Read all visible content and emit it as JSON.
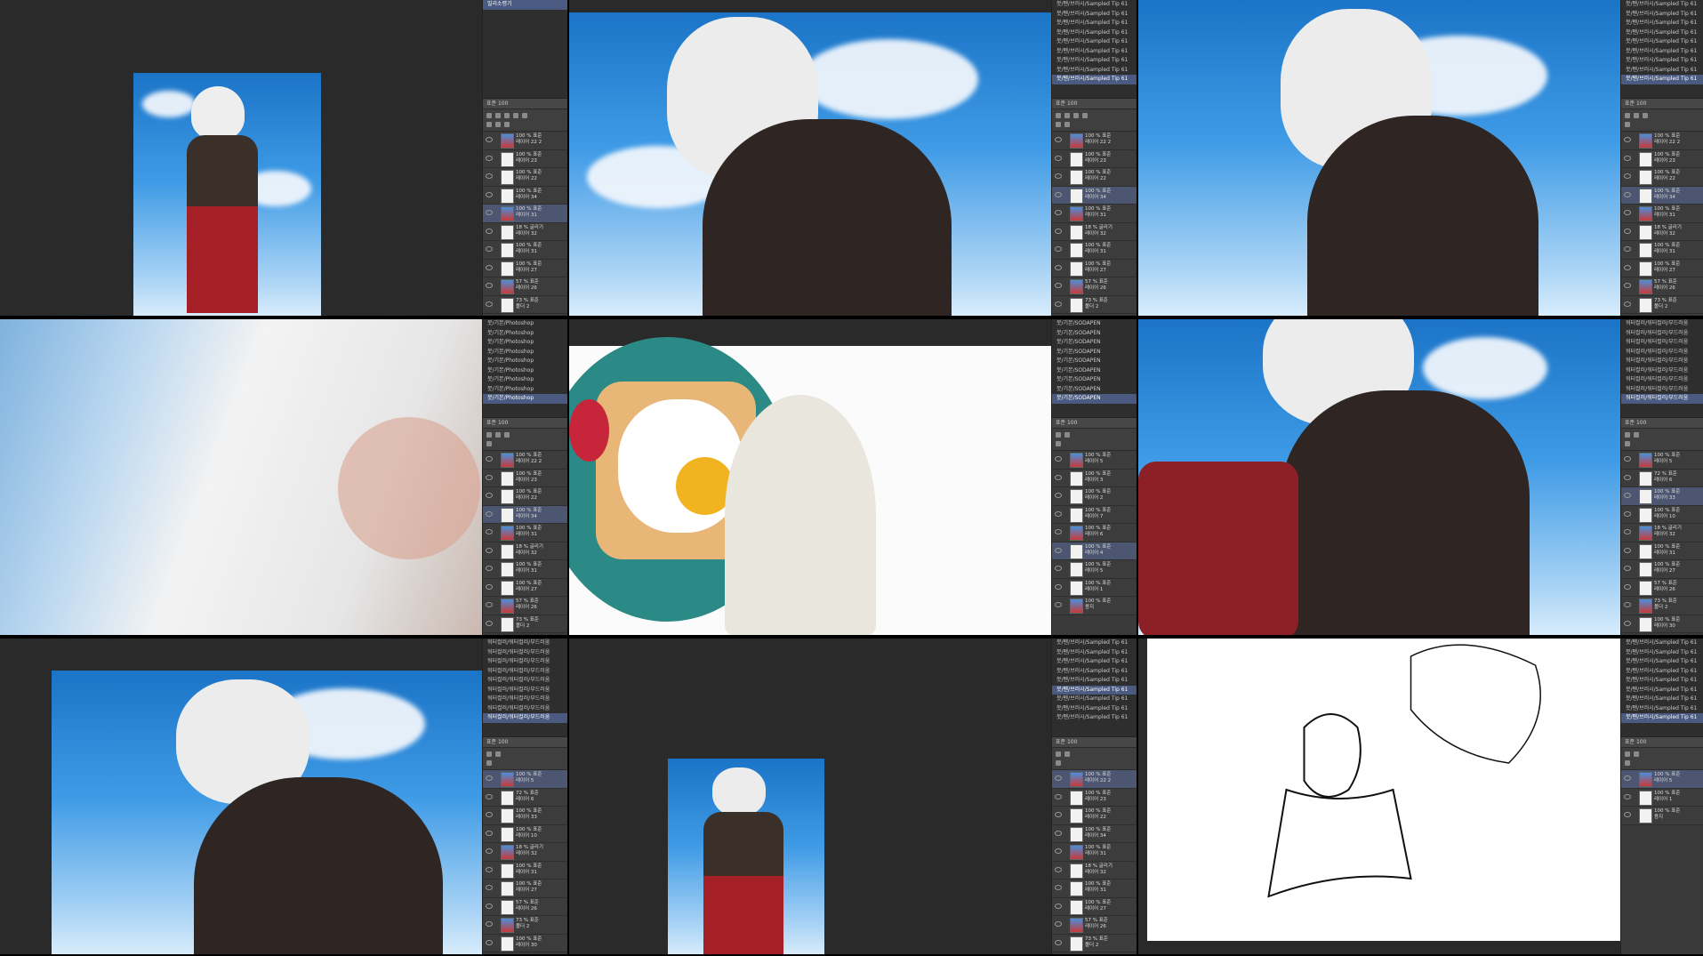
{
  "colors": {
    "sel": "#4a5a80",
    "panel": "#3a3a3a",
    "canvas": "#2a2a2a"
  },
  "icons": [
    "eye-icon",
    "layer-thumbnail"
  ],
  "brushes": {
    "sampled": [
      "붓/펜/브러시/Sampled Tip 61",
      "붓/펜/브러시/Sampled Tip 61",
      "붓/펜/브러시/Sampled Tip 61",
      "붓/펜/브러시/Sampled Tip 61",
      "붓/펜/브러시/Sampled Tip 61",
      "붓/펜/브러시/Sampled Tip 61",
      "붓/펜/브러시/Sampled Tip 61",
      "붓/펜/브러시/Sampled Tip 61",
      "붓/펜/브러시/Sampled Tip 61"
    ],
    "photoshop": [
      "붓/기본/Photoshop",
      "붓/기본/Photoshop",
      "붓/기본/Photoshop",
      "붓/기본/Photoshop",
      "붓/기본/Photoshop",
      "붓/기본/Photoshop",
      "붓/기본/Photoshop",
      "붓/기본/Photoshop",
      "붓/기본/Photoshop"
    ],
    "sodapen": [
      "붓/기본/SODAPEN",
      "붓/기본/SODAPEN",
      "붓/기본/SODAPEN",
      "붓/기본/SODAPEN",
      "붓/기본/SODAPEN",
      "붓/기본/SODAPEN",
      "붓/기본/SODAPEN",
      "붓/기본/SODAPEN",
      "붓/기본/SODAPEN"
    ],
    "watercolor": [
      "워터컬러/워터컬러/부드러움",
      "워터컬러/워터컬러/부드러움",
      "워터컬러/워터컬러/부드러움",
      "워터컬러/워터컬러/부드러움",
      "워터컬러/워터컬러/부드러움",
      "워터컬러/워터컬러/부드러움",
      "워터컬러/워터컬러/부드러움",
      "워터컬러/워터컬러/부드러움",
      "워터컬러/워터컬러/부드러움"
    ],
    "top_item": "밀리소령기"
  },
  "panel": {
    "blend": "표준",
    "opacity": "100"
  },
  "layers": {
    "a": [
      [
        "100 % 표준",
        "레이어 22 2"
      ],
      [
        "100 % 표준",
        "레이어 23"
      ],
      [
        "100 % 표준",
        "레이어 22"
      ],
      [
        "100 % 표준",
        "레이어 34"
      ],
      [
        "100 % 표준",
        "레이어 31"
      ],
      [
        "18 % 글리기",
        "레이어 32"
      ],
      [
        "100 % 표준",
        "레이어 31"
      ],
      [
        "100 % 표준",
        "레이어 27"
      ],
      [
        "57 % 표준",
        "레이어 26"
      ],
      [
        "73 % 표준",
        "폴더 2"
      ]
    ],
    "b": [
      [
        "100 % 표준",
        "레이어 5"
      ],
      [
        "100 % 표준",
        "레이어 3"
      ],
      [
        "100 % 표준",
        "레이어 2"
      ],
      [
        "100 % 표준",
        "레이어 7"
      ],
      [
        "100 % 표준",
        "레이어 6"
      ],
      [
        "100 % 표준",
        "레이어 4"
      ],
      [
        "100 % 표준",
        "레이어 5"
      ],
      [
        "100 % 표준",
        "레이어 1"
      ],
      [
        "100 % 표준",
        "용지"
      ]
    ],
    "c": [
      [
        "100 % 표준",
        "레이어 5"
      ],
      [
        "72 % 표준",
        "레이어 6"
      ],
      [
        "100 % 표준",
        "레이어 33"
      ],
      [
        "100 % 표준",
        "레이어 10"
      ],
      [
        "18 % 글리기",
        "레이어 32"
      ],
      [
        "100 % 표준",
        "레이어 31"
      ],
      [
        "100 % 표준",
        "레이어 27"
      ],
      [
        "57 % 표준",
        "레이어 26"
      ],
      [
        "73 % 표준",
        "폴더 2"
      ],
      [
        "100 % 표준",
        "레이어 30"
      ]
    ],
    "d": [
      [
        "100 % 표준",
        "레이어 5"
      ],
      [
        "100 % 표준",
        "레이어 1"
      ],
      [
        "100 % 표준",
        "용지"
      ]
    ]
  }
}
